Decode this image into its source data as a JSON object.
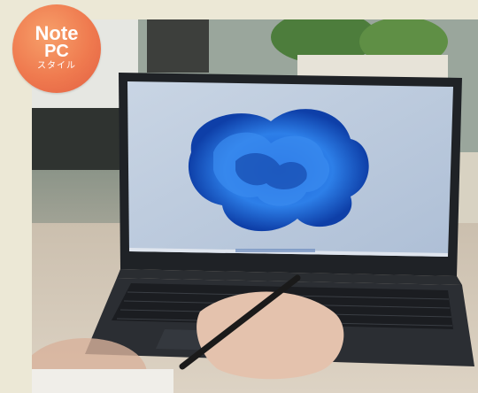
{
  "badge": {
    "line1": "Note",
    "line2": "PC",
    "line3": "スタイル"
  },
  "photo": {
    "subject": "laptop-with-stylus"
  }
}
